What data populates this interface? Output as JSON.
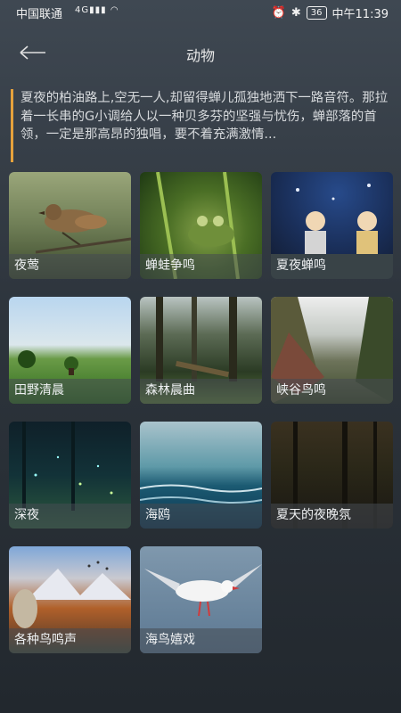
{
  "status_bar": {
    "carrier": "中国联通",
    "network": "4G",
    "battery": "36",
    "time": "中午11:39"
  },
  "nav": {
    "title": "动物"
  },
  "description": "夏夜的柏油路上,空无一人,却留得蝉儿孤独地洒下一路音符。那拉着一长串的G小调给人以一种贝多芬的坚强与忧伤，蝉部落的首领，一定是那高昂的独唱，要不着充满激情...",
  "items": [
    {
      "label": "夜莺"
    },
    {
      "label": "蝉蛙争鸣"
    },
    {
      "label": "夏夜蝉鸣"
    },
    {
      "label": "田野清晨"
    },
    {
      "label": "森林晨曲"
    },
    {
      "label": "峡谷鸟鸣"
    },
    {
      "label": "深夜"
    },
    {
      "label": "海鸥"
    },
    {
      "label": "夏天的夜晚氛"
    },
    {
      "label": "各种鸟鸣声"
    },
    {
      "label": "海鸟嬉戏"
    }
  ],
  "colors": {
    "accent_bar": "#e6a23c",
    "background_top": "#3f4852",
    "background_bottom": "#22282e"
  }
}
